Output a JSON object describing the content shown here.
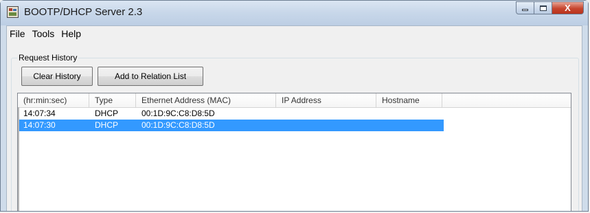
{
  "window": {
    "title": "BOOTP/DHCP Server 2.3"
  },
  "caption": {
    "close_glyph": "X"
  },
  "menu": {
    "items": [
      "File",
      "Tools",
      "Help"
    ]
  },
  "request_history": {
    "label": "Request History",
    "clear_button": "Clear History",
    "add_button": "Add to Relation List",
    "columns": [
      "(hr:min:sec)",
      "Type",
      "Ethernet Address (MAC)",
      "IP Address",
      "Hostname"
    ],
    "rows": [
      {
        "time": "14:07:34",
        "type": "DHCP",
        "mac": "00:1D:9C:C8:D8:5D",
        "ip": "",
        "hostname": "",
        "selected": false
      },
      {
        "time": "14:07:30",
        "type": "DHCP",
        "mac": "00:1D:9C:C8:D8:5D",
        "ip": "",
        "hostname": "",
        "selected": true
      }
    ]
  },
  "colors": {
    "selection": "#3399ff",
    "titlebar": "#c9d8ea",
    "close_button": "#c7462e"
  }
}
